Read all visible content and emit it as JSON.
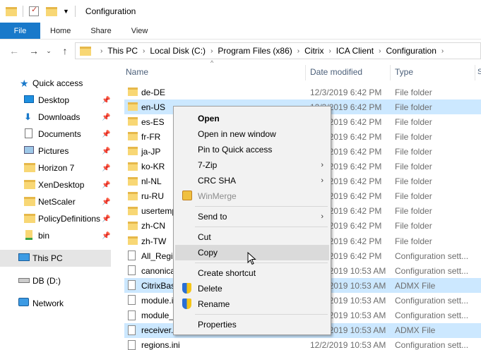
{
  "window": {
    "title": "Configuration"
  },
  "ribbon": {
    "tabs": [
      "File",
      "Home",
      "Share",
      "View"
    ]
  },
  "address": {
    "crumbs": [
      "This PC",
      "Local Disk (C:)",
      "Program Files (x86)",
      "Citrix",
      "ICA Client",
      "Configuration"
    ]
  },
  "nav": {
    "quick_access": "Quick access",
    "items": [
      {
        "label": "Desktop",
        "icon": "desktop-icon",
        "pinned": true
      },
      {
        "label": "Downloads",
        "icon": "downloads-icon",
        "pinned": true
      },
      {
        "label": "Documents",
        "icon": "documents-icon",
        "pinned": true
      },
      {
        "label": "Pictures",
        "icon": "pictures-icon",
        "pinned": true
      },
      {
        "label": "Horizon 7",
        "icon": "folder-icon",
        "pinned": true
      },
      {
        "label": "XenDesktop",
        "icon": "folder-icon",
        "pinned": true
      },
      {
        "label": "NetScaler",
        "icon": "folder-icon",
        "pinned": true
      },
      {
        "label": "PolicyDefinitions",
        "icon": "folder-icon",
        "pinned": true
      },
      {
        "label": "bin",
        "icon": "folder-icon",
        "pinned": true
      }
    ],
    "this_pc": "This PC",
    "drive": "DB (D:)",
    "network": "Network"
  },
  "columns": {
    "name": "Name",
    "date": "Date modified",
    "type": "Type"
  },
  "files": [
    {
      "name": "de-DE",
      "date": "12/3/2019 6:42 PM",
      "type": "File folder",
      "kind": "folder"
    },
    {
      "name": "en-US",
      "date": "12/3/2019 6:42 PM",
      "type": "File folder",
      "kind": "folder"
    },
    {
      "name": "es-ES",
      "date": "12/3/2019 6:42 PM",
      "type": "File folder",
      "kind": "folder"
    },
    {
      "name": "fr-FR",
      "date": "12/3/2019 6:42 PM",
      "type": "File folder",
      "kind": "folder"
    },
    {
      "name": "ja-JP",
      "date": "12/3/2019 6:42 PM",
      "type": "File folder",
      "kind": "folder"
    },
    {
      "name": "ko-KR",
      "date": "12/3/2019 6:42 PM",
      "type": "File folder",
      "kind": "folder"
    },
    {
      "name": "nl-NL",
      "date": "12/3/2019 6:42 PM",
      "type": "File folder",
      "kind": "folder"
    },
    {
      "name": "ru-RU",
      "date": "12/3/2019 6:42 PM",
      "type": "File folder",
      "kind": "folder"
    },
    {
      "name": "usertemp",
      "date": "12/3/2019 6:42 PM",
      "type": "File folder",
      "kind": "folder"
    },
    {
      "name": "zh-CN",
      "date": "12/3/2019 6:42 PM",
      "type": "File folder",
      "kind": "folder"
    },
    {
      "name": "zh-TW",
      "date": "12/3/2019 6:42 PM",
      "type": "File folder",
      "kind": "folder"
    },
    {
      "name": "All_Regio",
      "date": "12/3/2019 6:42 PM",
      "type": "Configuration sett...",
      "kind": "file"
    },
    {
      "name": "canonica",
      "date": "12/2/2019 10:53 AM",
      "type": "Configuration sett...",
      "kind": "file"
    },
    {
      "name": "CitrixBas",
      "date": "12/2/2019 10:53 AM",
      "type": "ADMX File",
      "kind": "file"
    },
    {
      "name": "module.i",
      "date": "12/2/2019 10:53 AM",
      "type": "Configuration sett...",
      "kind": "file"
    },
    {
      "name": "module_",
      "date": "12/2/2019 10:53 AM",
      "type": "Configuration sett...",
      "kind": "file"
    },
    {
      "name": "receiver.",
      "date": "12/2/2019 10:53 AM",
      "type": "ADMX File",
      "kind": "file"
    },
    {
      "name": "regions.ini",
      "date": "12/2/2019 10:53 AM",
      "type": "Configuration sett...",
      "kind": "file"
    }
  ],
  "context_menu": {
    "open": "Open",
    "open_new_window": "Open in new window",
    "pin_quick": "Pin to Quick access",
    "seven_zip": "7-Zip",
    "crc_sha": "CRC SHA",
    "winmerge": "WinMerge",
    "send_to": "Send to",
    "cut": "Cut",
    "copy": "Copy",
    "create_shortcut": "Create shortcut",
    "delete": "Delete",
    "rename": "Rename",
    "properties": "Properties"
  },
  "colors": {
    "accent": "#1979ca",
    "selection": "#cce8ff",
    "folder": "#f8d775"
  }
}
